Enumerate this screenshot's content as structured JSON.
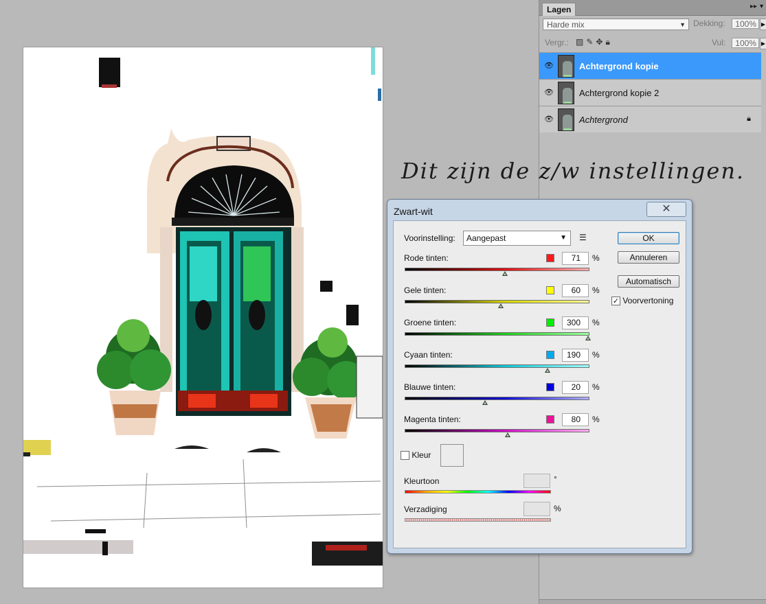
{
  "layers_panel": {
    "tab_label": "Lagen",
    "blend_mode": "Harde mix",
    "opacity_label": "Dekking:",
    "opacity_value": "100%",
    "lock_label": "Vergr.:",
    "fill_label": "Vul:",
    "fill_value": "100%",
    "layers": [
      {
        "name": "Achtergrond kopie",
        "selected": true
      },
      {
        "name": "Achtergrond kopie 2",
        "selected": false
      },
      {
        "name": "Achtergrond",
        "selected": false,
        "locked": true
      }
    ]
  },
  "note": "Dit zijn de z/w instellingen.",
  "dialog": {
    "title": "Zwart-wit",
    "close_symbol": "✕",
    "preset_label": "Voorinstelling:",
    "preset_value": "Aangepast",
    "buttons": {
      "ok": "OK",
      "cancel": "Annuleren",
      "auto": "Automatisch"
    },
    "preview_label": "Voorvertoning",
    "preview_checked": true,
    "percent_symbol": "%",
    "sliders": [
      {
        "label": "Rode tinten:",
        "value": "71",
        "fraction": 0.545,
        "swatch": "#ff1a1a",
        "track_from": "#000000",
        "track_to": "#ffb0b0",
        "track_mid": "#e01010"
      },
      {
        "label": "Gele tinten:",
        "value": "60",
        "fraction": 0.525,
        "swatch": "#ffff00",
        "track_from": "#000000",
        "track_to": "#ffff9a",
        "track_mid": "#d8d800"
      },
      {
        "label": "Groene tinten:",
        "value": "300",
        "fraction": 1.0,
        "swatch": "#00ee00",
        "track_from": "#000000",
        "track_to": "#a0ffa0",
        "track_mid": "#20d020"
      },
      {
        "label": "Cyaan tinten:",
        "value": "190",
        "fraction": 0.78,
        "swatch": "#00aaee",
        "track_from": "#000000",
        "track_to": "#a0ffff",
        "track_mid": "#10c8d8"
      },
      {
        "label": "Blauwe tinten:",
        "value": "20",
        "fraction": 0.44,
        "swatch": "#0000e0",
        "track_from": "#000000",
        "track_to": "#b0b0ff",
        "track_mid": "#1010d8"
      },
      {
        "label": "Magenta tinten:",
        "value": "80",
        "fraction": 0.56,
        "swatch": "#ee1199",
        "track_from": "#000000",
        "track_to": "#ffb0f0",
        "track_mid": "#d010c8"
      }
    ],
    "tint_label": "Kleur",
    "hue_label": "Kleurtoon",
    "hue_unit": "°",
    "saturation_label": "Verzadiging",
    "saturation_unit": "%"
  }
}
